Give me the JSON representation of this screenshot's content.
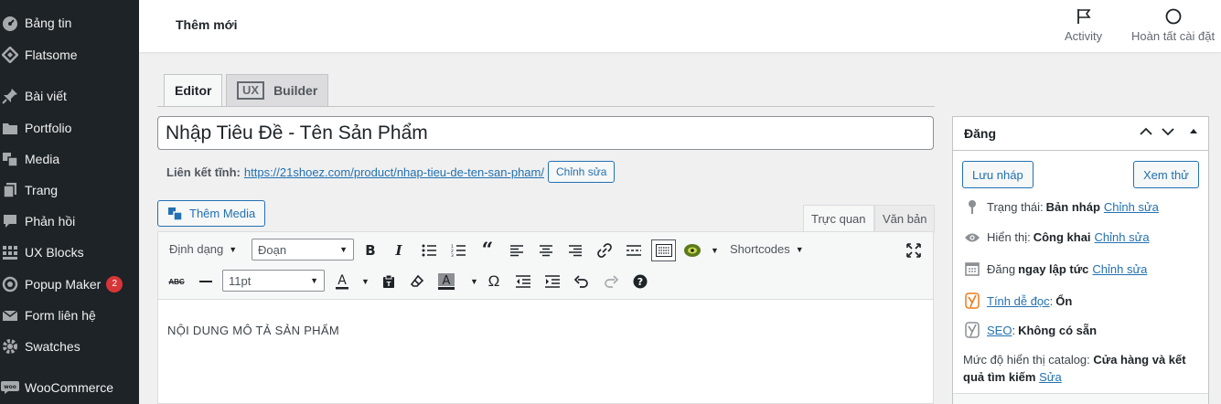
{
  "sidebar": {
    "items": [
      {
        "label": "Bảng tin",
        "icon": "dashboard-icon"
      },
      {
        "label": "Flatsome",
        "icon": "flatsome-icon"
      },
      {
        "label": "Bài viết",
        "icon": "pin-icon"
      },
      {
        "label": "Portfolio",
        "icon": "folder-icon"
      },
      {
        "label": "Media",
        "icon": "media-icon"
      },
      {
        "label": "Trang",
        "icon": "page-icon"
      },
      {
        "label": "Phản hồi",
        "icon": "comment-icon"
      },
      {
        "label": "UX Blocks",
        "icon": "grid-icon"
      },
      {
        "label": "Popup Maker",
        "icon": "popup-icon",
        "badge": "2"
      },
      {
        "label": "Form liên hệ",
        "icon": "mail-icon"
      },
      {
        "label": "Swatches",
        "icon": "gear-icon"
      },
      {
        "label": "WooCommerce",
        "icon": "woo-icon"
      }
    ]
  },
  "header": {
    "title": "Thêm mới",
    "activity_label": "Activity",
    "setup_label": "Hoàn tất cài đặt"
  },
  "editor_tabs": {
    "editor": "Editor",
    "ux_box": "UX",
    "builder": "Builder"
  },
  "post": {
    "title_value": "Nhập Tiêu Đề - Tên Sản Phẩm",
    "permalink_label": "Liên kết tĩnh:",
    "permalink_base": "https://21shoez.com/product/",
    "permalink_slug": "nhap-tieu-de-ten-san-pham",
    "permalink_tail": "/",
    "edit_slug_label": "Chỉnh sửa",
    "add_media_label": "Thêm Media",
    "tab_visual": "Trực quan",
    "tab_text": "Văn bản",
    "content": "NỘI DUNG MÔ TẢ SẢN PHẨM"
  },
  "toolbar": {
    "format_label": "Định dạng",
    "paragraph_select": "Đoạn",
    "shortcodes_label": "Shortcodes",
    "font_size": "11pt"
  },
  "publish": {
    "title": "Đăng",
    "save_draft": "Lưu nháp",
    "preview": "Xem thử",
    "status_label": "Trạng thái:",
    "status_value": "Bản nháp",
    "status_edit": "Chỉnh sửa",
    "visibility_label": "Hiển thị:",
    "visibility_value": "Công khai",
    "visibility_edit": "Chỉnh sửa",
    "schedule_label": "Đăng",
    "schedule_value": "ngay lập tức",
    "schedule_edit": "Chỉnh sửa",
    "readability_link": "Tính dễ đọc",
    "readability_value": "Ổn",
    "seo_link": "SEO",
    "seo_value": "Không có sẵn",
    "catalog_label": "Mức độ hiển thị catalog:",
    "catalog_value": "Cửa hàng và kết quả tìm kiếm",
    "catalog_edit": "Sửa"
  },
  "colors": {
    "sidebar_bg": "#1d2327",
    "accent": "#2271b1",
    "badge": "#d63638",
    "yoast_orange": "#ee7c1b"
  }
}
